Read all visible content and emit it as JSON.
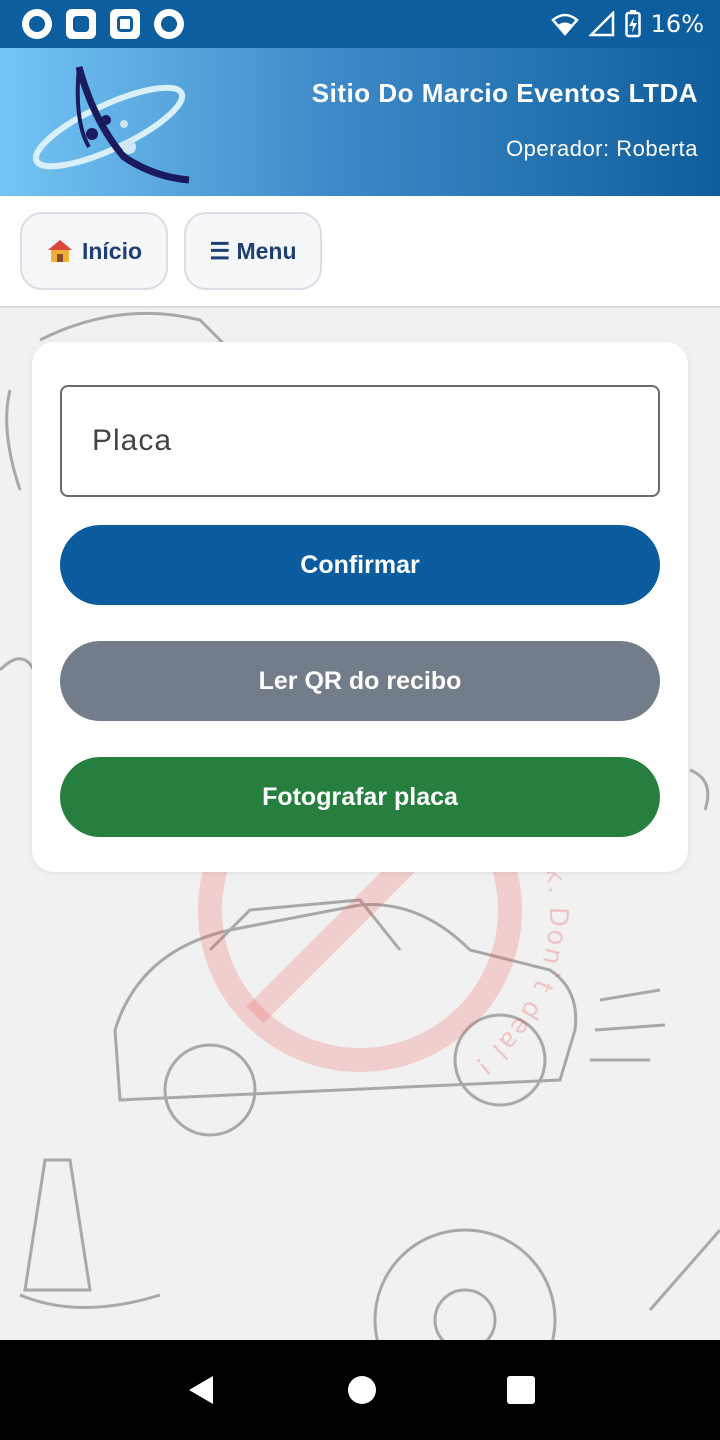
{
  "status_bar": {
    "battery": "16%",
    "left_icons": [
      "app-icon",
      "screenshot-icon",
      "grid-app-icon",
      "app-icon"
    ],
    "right_icons": [
      "wifi-icon",
      "signal-icon",
      "battery-charging-icon"
    ]
  },
  "header": {
    "company": "Sitio Do Marcio Eventos LTDA",
    "operator": "Operador: Roberta"
  },
  "nav": {
    "home_label": "Início",
    "menu_label": "☰ Menu"
  },
  "form": {
    "placa_placeholder": "Placa",
    "placa_value": "",
    "confirm_label": "Confirmar",
    "qr_label": "Ler QR do recibo",
    "photo_label": "Fotografar placa"
  },
  "watermark": {
    "text": "This device at risk. Don`t deal !"
  },
  "colors": {
    "status_bar": "#0d5e9f",
    "confirm": "#0b5c9e",
    "qr": "#737d89",
    "photo": "#277f3f",
    "nav_text": "#1e3f73"
  }
}
